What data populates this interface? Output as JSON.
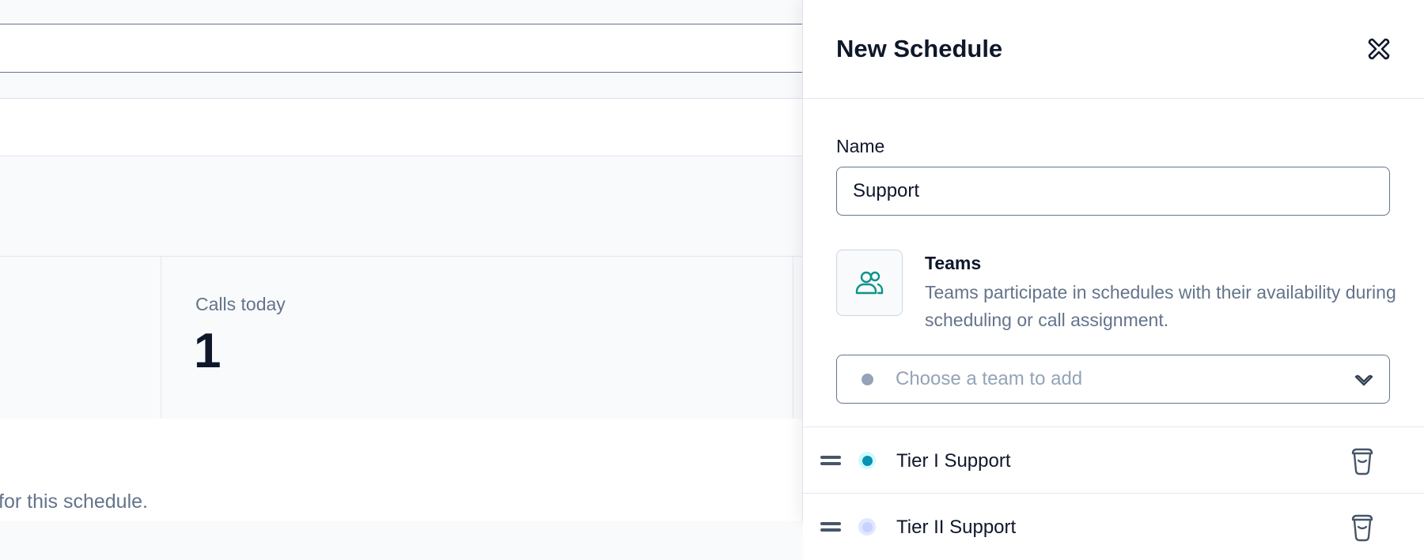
{
  "background": {
    "stat": {
      "label": "Calls today",
      "value": "1"
    },
    "hint_text": "for this schedule."
  },
  "panel": {
    "title": "New Schedule",
    "close_icon": "close-icon",
    "name_field": {
      "label": "Name",
      "value": "Support"
    },
    "teams": {
      "icon": "users-icon",
      "title": "Teams",
      "description": "Teams participate in schedules with their availability during scheduling or call assignment.",
      "select_placeholder": "Choose a team to add"
    },
    "team_list": [
      {
        "name": "Tier I Support",
        "color": "#0891b2"
      },
      {
        "name": "Tier II Support",
        "color": "#c7d2fe"
      }
    ]
  },
  "colors": {
    "accent_teal": "#0d9488",
    "text_primary": "#0f172a",
    "text_muted": "#64748b",
    "border": "#64748b"
  }
}
